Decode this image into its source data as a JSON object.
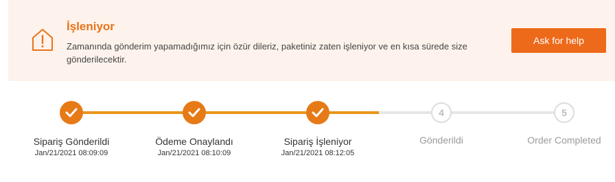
{
  "alert": {
    "title": "İşleniyor",
    "message": "Zamanında gönderim yapamadığımız için özür dileriz, paketiniz zaten işleniyor ve en kısa sürede size gönderilecektir.",
    "button_label": "Ask for help",
    "icon": "warning-house-icon",
    "accent_color": "#e8731a"
  },
  "steps": [
    {
      "label": "Sipariş Gönderildi",
      "time": "Jan/21/2021 08:09:09",
      "status": "done",
      "icon": "check-icon"
    },
    {
      "label": "Ödeme Onaylandı",
      "time": "Jan/21/2021 08:10:09",
      "status": "done",
      "icon": "check-icon"
    },
    {
      "label": "Sipariş İşleniyor",
      "time": "Jan/21/2021 08:12:05",
      "status": "done",
      "icon": "check-icon"
    },
    {
      "label": "Gönderildi",
      "number": "4",
      "status": "pending"
    },
    {
      "label": "Order Completed",
      "number": "5",
      "status": "pending"
    }
  ],
  "colors": {
    "done": "#e67a17",
    "track_done": "#e8941a",
    "track_pending": "#e6e6e6",
    "button": "#ee6a1b"
  }
}
